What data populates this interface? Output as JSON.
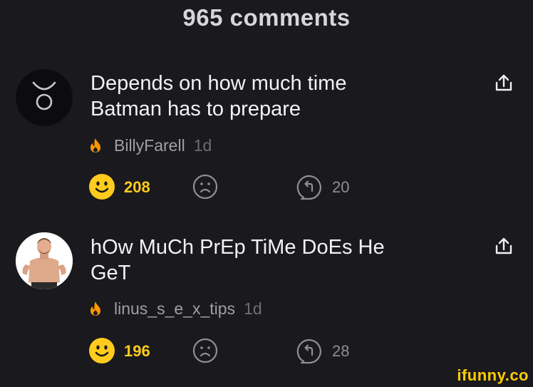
{
  "header": {
    "title": "965 comments"
  },
  "comments": [
    {
      "text_line1": "Depends on how much time",
      "text_line2": "Batman has to prepare",
      "author": "BillyFarell",
      "age": "1d",
      "likes": "208",
      "replies": "20",
      "avatar_icon": "taurus-symbol-icon"
    },
    {
      "text_line1": "hOw MuCh PrEp TiMe DoEs He",
      "text_line2": "GeT",
      "author": "linus_s_e_x_tips",
      "age": "1d",
      "likes": "196",
      "replies": "28",
      "avatar_icon": "user-photo"
    }
  ],
  "watermark": "ifunny.co",
  "colors": {
    "background": "#1a191e",
    "accent_yellow": "#ffcc1e",
    "flame_orange": "#ff9800",
    "muted_text": "#9f9fa4"
  }
}
